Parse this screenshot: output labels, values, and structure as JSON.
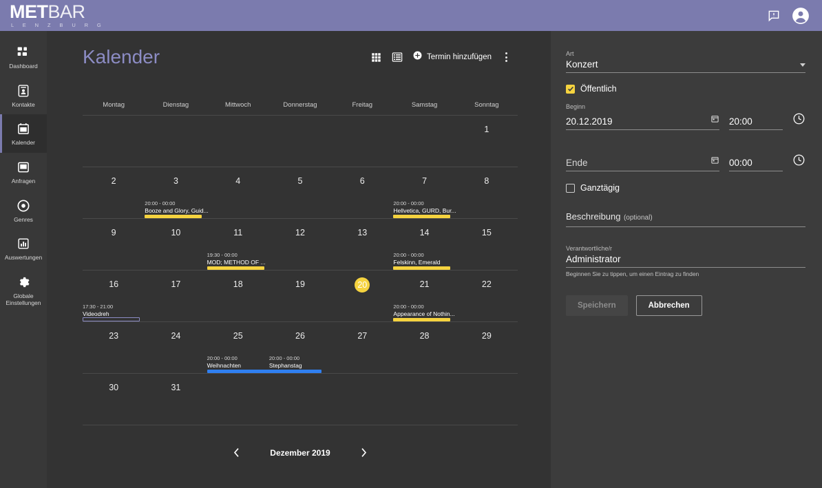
{
  "topbar": {
    "logo_bold": "MET",
    "logo_light": "BAR",
    "logo_sub": "L E N Z B U R G",
    "feedback_icon": "feedback-speech-bubble-icon",
    "account_icon": "account-circle-icon",
    "brand_color": "#7b7bae"
  },
  "sidebar": {
    "items": [
      {
        "label": "Dashboard",
        "icon": "dashboard-grid-icon",
        "active": false
      },
      {
        "label": "Kontakte",
        "icon": "contacts-card-icon",
        "active": false
      },
      {
        "label": "Kalender",
        "icon": "calendar-icon",
        "active": true
      },
      {
        "label": "Anfragen",
        "icon": "inbox-icon",
        "active": false
      },
      {
        "label": "Genres",
        "icon": "disc-icon",
        "active": false
      },
      {
        "label": "Auswertungen",
        "icon": "bar-chart-icon",
        "active": false
      },
      {
        "label": "Globale Einstellungen",
        "icon": "gear-icon",
        "active": false
      }
    ]
  },
  "main": {
    "title": "Kalender",
    "grid_view_icon": "grid-view-icon",
    "list_view_icon": "list-view-icon",
    "add_icon": "plus-circle-icon",
    "add_label": "Termin hinzufügen",
    "more_icon": "kebab-menu-icon",
    "weekdays": [
      "Montag",
      "Dienstag",
      "Mittwoch",
      "Donnerstag",
      "Freitag",
      "Samstag",
      "Sonntag"
    ],
    "footer": {
      "prev_icon": "chevron-left-icon",
      "month_label": "Dezember 2019",
      "next_icon": "chevron-right-icon"
    },
    "accent_yellow": "#f5d33f",
    "accent_blue": "#2f7ff0",
    "accent_violet": "#8c8cc4",
    "today": 20,
    "weeks": [
      {
        "days": [
          null,
          null,
          null,
          null,
          null,
          null,
          1
        ]
      },
      {
        "days": [
          2,
          3,
          4,
          5,
          6,
          7,
          8
        ]
      },
      {
        "days": [
          9,
          10,
          11,
          12,
          13,
          14,
          15
        ]
      },
      {
        "days": [
          16,
          17,
          18,
          19,
          20,
          21,
          22
        ]
      },
      {
        "days": [
          23,
          24,
          25,
          26,
          27,
          28,
          29
        ]
      },
      {
        "days": [
          30,
          31,
          null,
          null,
          null,
          null,
          null
        ]
      }
    ],
    "events": [
      {
        "week": 1,
        "col": 1,
        "span": 1,
        "time": "20:00 - 00:00",
        "name": "Booze and Glory, Guid...",
        "style": "filled-yellow"
      },
      {
        "week": 1,
        "col": 5,
        "span": 1,
        "time": "20:00 - 00:00",
        "name": "Hellvetica, GURD, Bur...",
        "style": "filled-yellow"
      },
      {
        "week": 2,
        "col": 2,
        "span": 1,
        "time": "19:30 - 00:00",
        "name": "MOD; METHOD OF ...",
        "style": "filled-yellow"
      },
      {
        "week": 2,
        "col": 5,
        "span": 1,
        "time": "20:00 - 00:00",
        "name": "Felskinn, Emerald",
        "style": "filled-yellow"
      },
      {
        "week": 3,
        "col": 0,
        "span": 1,
        "time": "17:30 - 21:00",
        "name": "Videodreh",
        "style": "outline-violet"
      },
      {
        "week": 3,
        "col": 5,
        "span": 1,
        "time": "20:00 - 00:00",
        "name": "Appearance of Nothin...",
        "style": "filled-yellow"
      },
      {
        "week": 4,
        "col": 2,
        "span": 2,
        "time": "20:00 - 00:00",
        "name": "Weihnachten",
        "style": "filled-blue"
      },
      {
        "week": 4,
        "col": 3,
        "span": 0,
        "time": "20:00 - 00:00",
        "name": "Stephanstag",
        "style": "none"
      }
    ]
  },
  "panel": {
    "art_label": "Art",
    "art_value": "Konzert",
    "art_caret_icon": "chevron-down-icon",
    "public_label": "Öffentlich",
    "public_checked": true,
    "begin_label": "Beginn",
    "begin_date": "20.12.2019",
    "begin_time": "20:00",
    "end_date_placeholder": "Ende",
    "end_time": "00:00",
    "date_icon": "calendar-picker-icon",
    "clock_icon": "clock-icon",
    "allday_label": "Ganztägig",
    "allday_checked": false,
    "description_label": "Beschreibung",
    "description_optional": "(optional)",
    "responsible_label": "Verantwortliche/r",
    "responsible_value": "Administrator",
    "responsible_hint": "Beginnen Sie zu tippen, um einen Eintrag zu finden",
    "save_label": "Speichern",
    "cancel_label": "Abbrechen"
  }
}
